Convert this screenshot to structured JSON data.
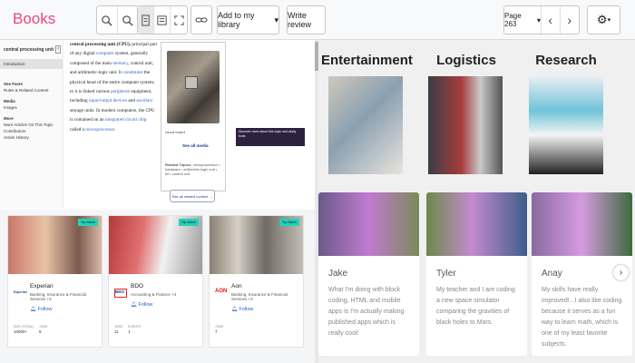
{
  "toolbar": {
    "logo": "Books",
    "add_library": "Add to my library",
    "write_review": "Write review",
    "page": "Page 263"
  },
  "toc": {
    "title": "central processing unit",
    "items": [
      "Introduction",
      "See Facts",
      "Rules & Related Content",
      "Media",
      "Images",
      "More",
      "More Articles On This Topic",
      "Contributors",
      "Article History"
    ]
  },
  "article": {
    "w1": "central processing unit",
    "w2": "(CPU),",
    "w3": "principal part of any digital",
    "l1": "computer",
    "w4": "system, generally composed of the main",
    "l2": "memory",
    "w5": ", control unit, and arithmetic-logic unit. It",
    "l3": "constitutes",
    "w6": "the physical heart of the entire computer system; to it is linked various",
    "l4": "peripheral",
    "w7": "equipment, including",
    "l5": "input/output devices",
    "w8": "and",
    "l6": "auxiliary",
    "w9": "storage units. In modern computers, the CPU is contained on an",
    "l7": "integrated circuit chip",
    "w10": "called a",
    "l8": "microprocessor",
    "w11": "."
  },
  "infobox": {
    "caption": "circuit board",
    "see_all": "See all media",
    "related_label": "Related Topics:",
    "related_text": "microprocessor • hardware • arithmetic-logic unit • bit • control unit",
    "see_related": "See all related content →"
  },
  "ad": {
    "text": "Discover more about this topic and study tools"
  },
  "employers": [
    {
      "name": "Experian",
      "industry": "Banking, Insurance & Financial Services +3",
      "follow": "Follow",
      "badge": "Top Match",
      "mini": "Experian",
      "s1l": "SIZE (TOTAL)",
      "s1": "10000+",
      "s2l": "JOBS",
      "s2": "9"
    },
    {
      "name": "BDO",
      "industry": "Accounting & Finance +3",
      "follow": "Follow",
      "badge": "Top Match",
      "mini": "BDO",
      "s1l": "JOBS",
      "s1": "11",
      "s2l": "EVENTS",
      "s2": "1"
    },
    {
      "name": "Aon",
      "industry": "Banking, Insurance & Financial Services +3",
      "follow": "Follow",
      "badge": "Top Match",
      "mini": "AON",
      "s1l": "JOBS",
      "s1": "7",
      "s2l": "",
      "s2": ""
    }
  ],
  "categories": [
    "Entertainment",
    "Logistics",
    "Research"
  ],
  "students": [
    {
      "name": "Jake",
      "quote": "What I'm doing with block coding, HTML and mobile apps is I'm actually making published apps which is really cool!"
    },
    {
      "name": "Tyler",
      "quote": "My teacher and I are coding a new space simulator comparing the gravities of black holes to Mars."
    },
    {
      "name": "Anay",
      "quote": "My skills have really improved!...I also like coding because it serves as a fun way to learn math, which is one of my least favorite subjects."
    }
  ],
  "colors": {
    "logo": "#e8467c",
    "badge": "#22d3b5",
    "link": "#3366cc",
    "follow": "#2c64c8"
  }
}
